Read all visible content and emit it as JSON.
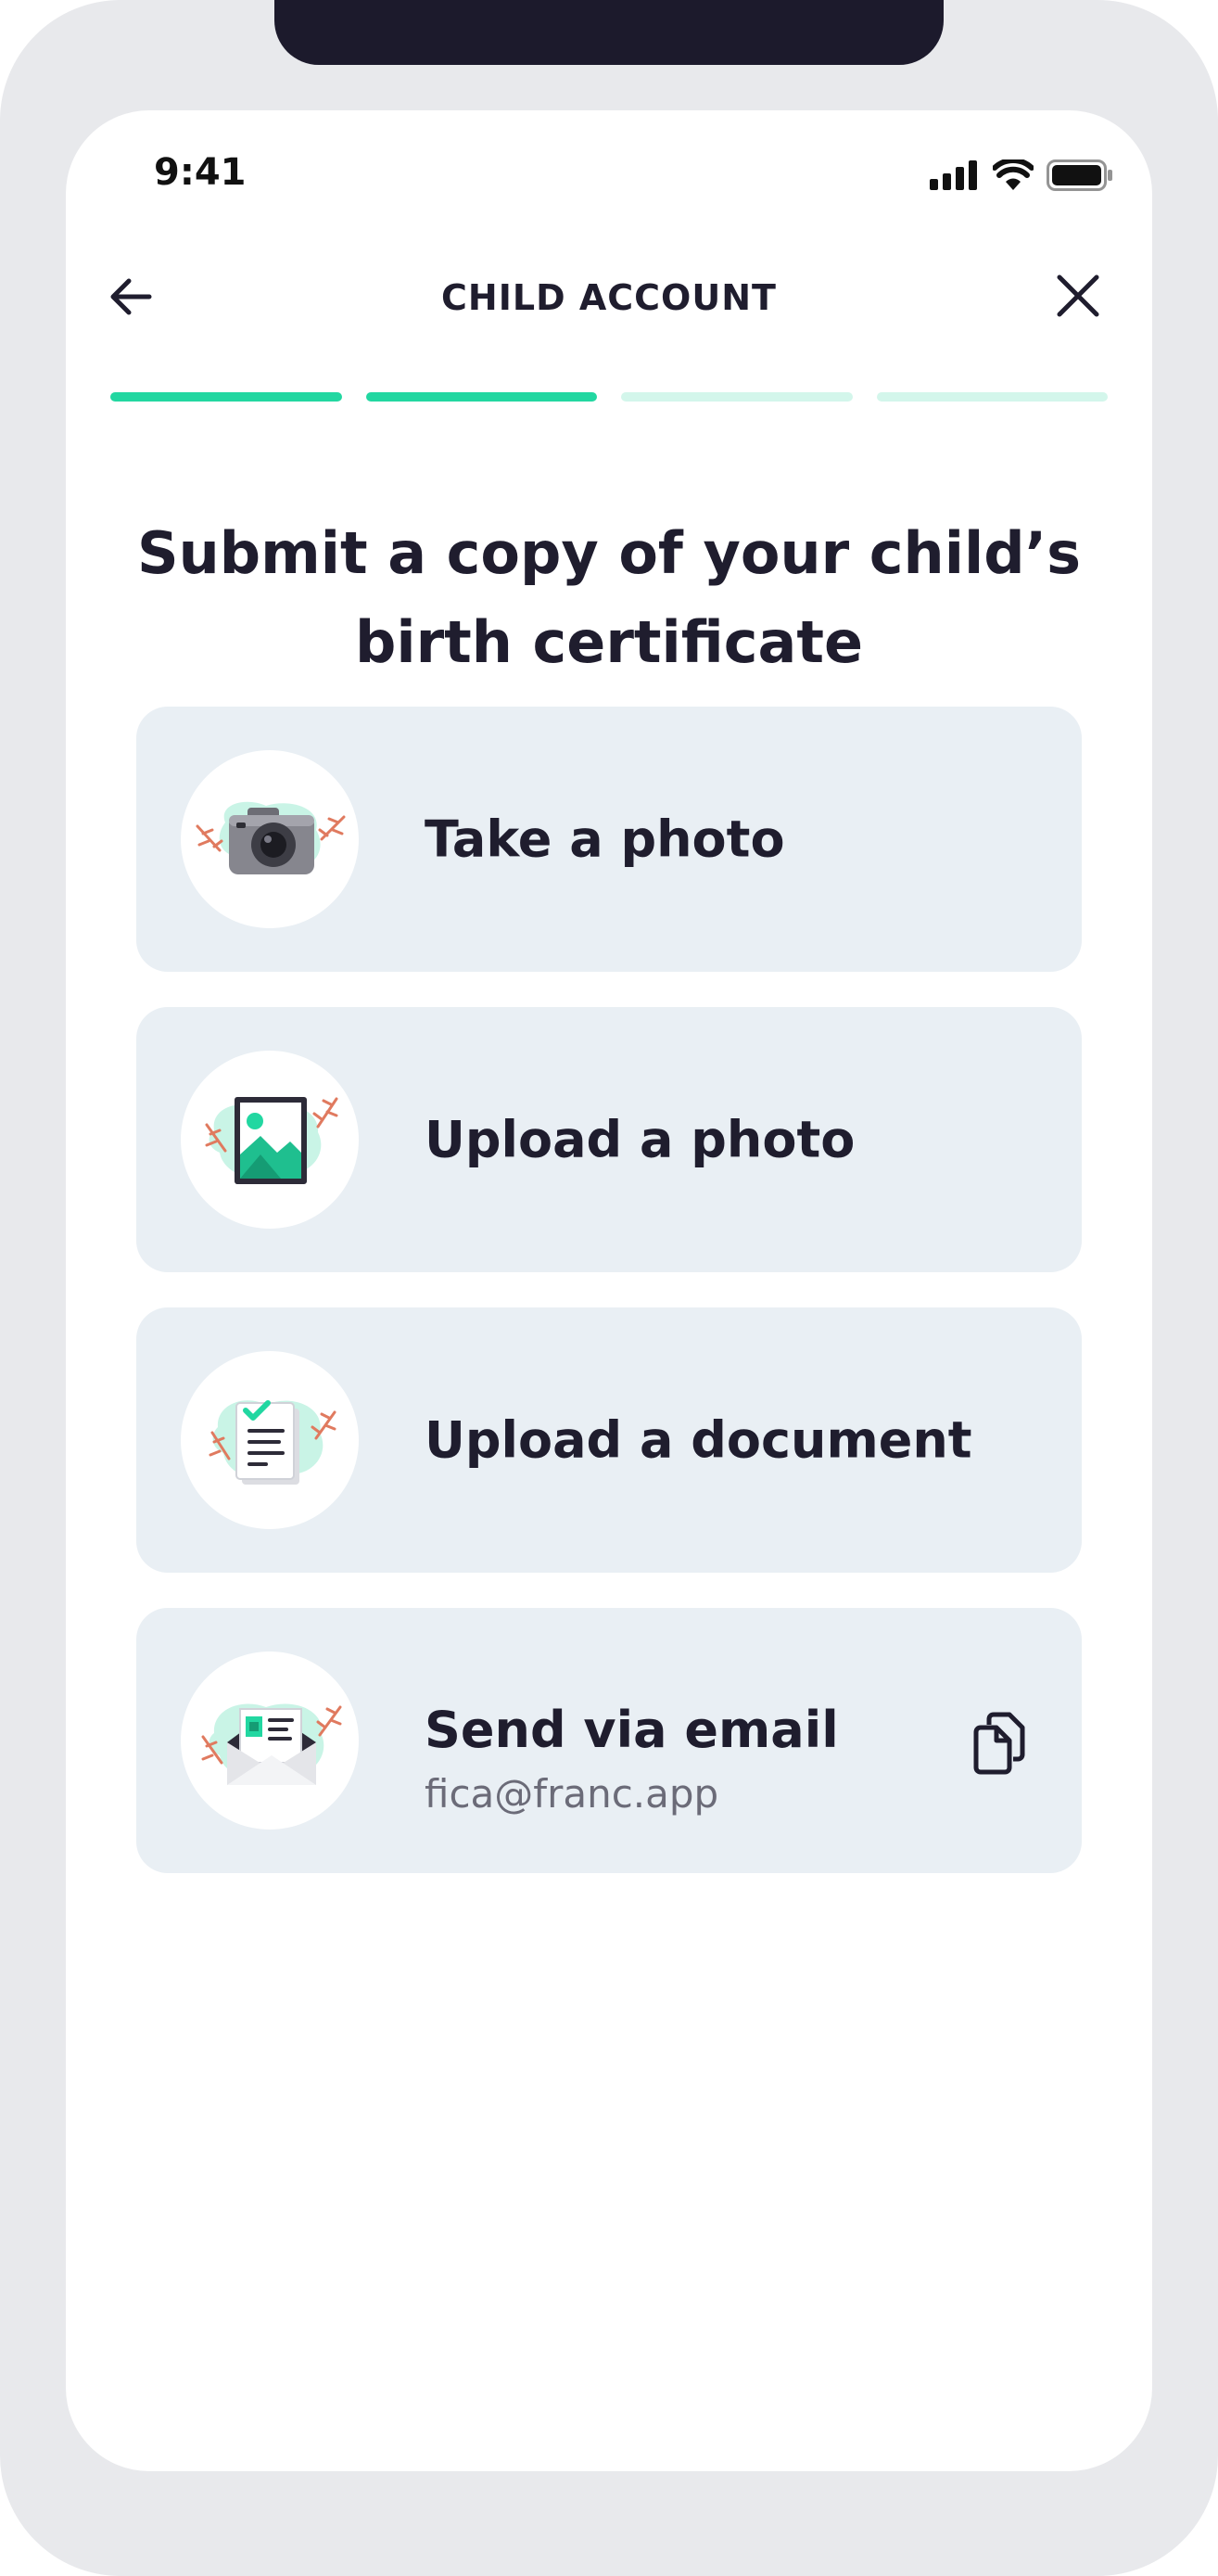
{
  "status_bar": {
    "time": "9:41"
  },
  "header": {
    "title": "CHILD ACCOUNT"
  },
  "progress": {
    "total_steps": 4,
    "completed_steps": 2
  },
  "heading": "Submit a copy of your child’s birth certificate",
  "options": [
    {
      "label": "Take a photo",
      "icon": "camera-icon"
    },
    {
      "label": "Upload a photo",
      "icon": "image-icon"
    },
    {
      "label": "Upload a document",
      "icon": "document-icon"
    },
    {
      "label": "Send via email",
      "sublabel": "fica@franc.app",
      "icon": "envelope-icon",
      "action_icon": "copy-icon"
    }
  ],
  "colors": {
    "accent": "#22d7a1",
    "accent_light": "#d3f6eb",
    "card_bg": "#e9eff4",
    "text_primary": "#1f1d2e",
    "text_secondary": "#6b6b78",
    "device_frame": "#e8e9ec"
  }
}
